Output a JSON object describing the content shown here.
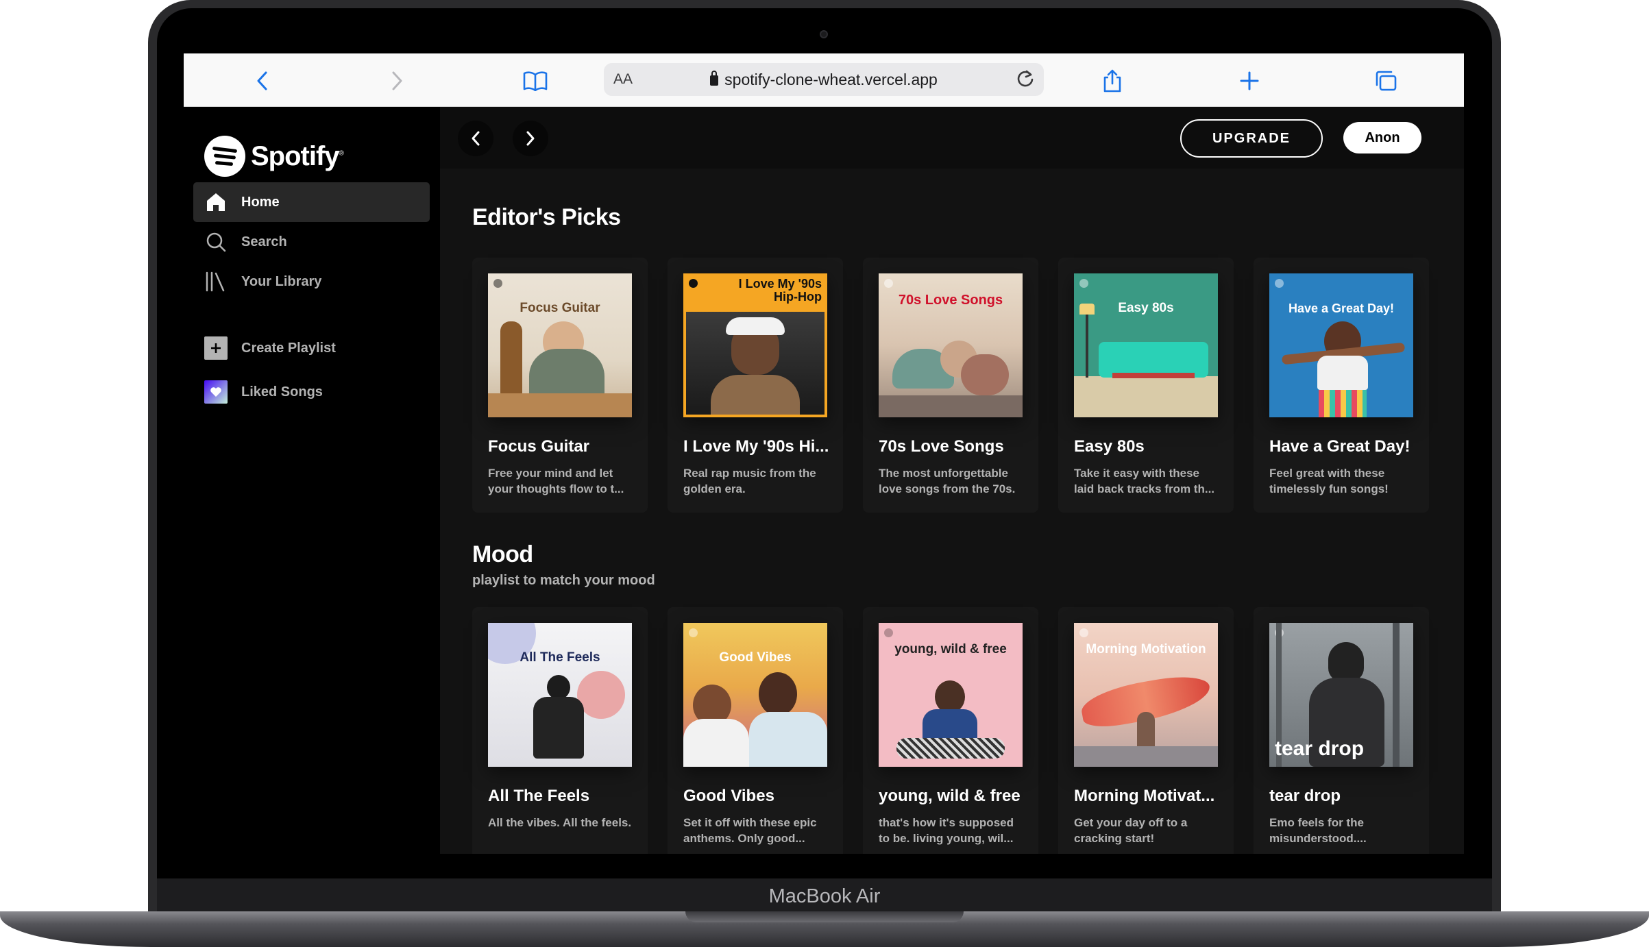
{
  "device": {
    "label": "MacBook Air"
  },
  "browser": {
    "font_size_label": "AA",
    "url": "spotify-clone-wheat.vercel.app",
    "icons": [
      "back-icon",
      "forward-icon",
      "bookmarks-icon",
      "lock-icon",
      "reload-icon",
      "share-icon",
      "new-tab-icon",
      "tabs-icon"
    ]
  },
  "brand": {
    "name": "Spotify",
    "trademark": "®",
    "accent": "#1db954"
  },
  "sidebar": {
    "items": [
      {
        "label": "Home",
        "icon": "home-icon",
        "active": true
      },
      {
        "label": "Search",
        "icon": "search-icon",
        "active": false
      },
      {
        "label": "Your Library",
        "icon": "library-icon",
        "active": false
      }
    ],
    "actions": [
      {
        "label": "Create Playlist",
        "icon": "plus-icon"
      },
      {
        "label": "Liked Songs",
        "icon": "heart-icon"
      }
    ]
  },
  "topbar": {
    "back_icon": "chevron-left-icon",
    "forward_icon": "chevron-right-icon",
    "upgrade_label": "UPGRADE",
    "user_label": "Anon"
  },
  "sections": [
    {
      "title": "Editor's Picks",
      "subtitle": "",
      "cards": [
        {
          "art_text": "Focus Guitar",
          "name": "Focus Guitar",
          "description": "Free your mind and let your thoughts flow to t..."
        },
        {
          "art_text": "I Love My '90s Hip-Hop",
          "name": "I Love My '90s Hi...",
          "description": "Real rap music from the golden era."
        },
        {
          "art_text": "70s Love Songs",
          "name": "70s Love Songs",
          "description": "The most unforgettable love songs from the 70s."
        },
        {
          "art_text": "Easy 80s",
          "name": "Easy 80s",
          "description": "Take it easy with these laid back tracks from th..."
        },
        {
          "art_text": "Have a Great Day!",
          "name": "Have a Great Day!",
          "description": "Feel great with these timelessly fun songs!"
        }
      ]
    },
    {
      "title": "Mood",
      "subtitle": "playlist to match your mood",
      "cards": [
        {
          "art_text": "All The Feels",
          "name": "All The Feels",
          "description": "All the vibes. All the feels."
        },
        {
          "art_text": "Good Vibes",
          "name": "Good Vibes",
          "description": "Set it off with these epic anthems. Only good..."
        },
        {
          "art_text": "young, wild & free",
          "name": "young, wild & free",
          "description": "that's how it's supposed to be. living young, wil..."
        },
        {
          "art_text": "Morning Motivation",
          "name": "Morning Motivat...",
          "description": "Get your day off to a cracking start!"
        },
        {
          "art_text": "tear drop",
          "name": "tear drop",
          "description": "Emo feels for the misunderstood...."
        }
      ]
    }
  ]
}
